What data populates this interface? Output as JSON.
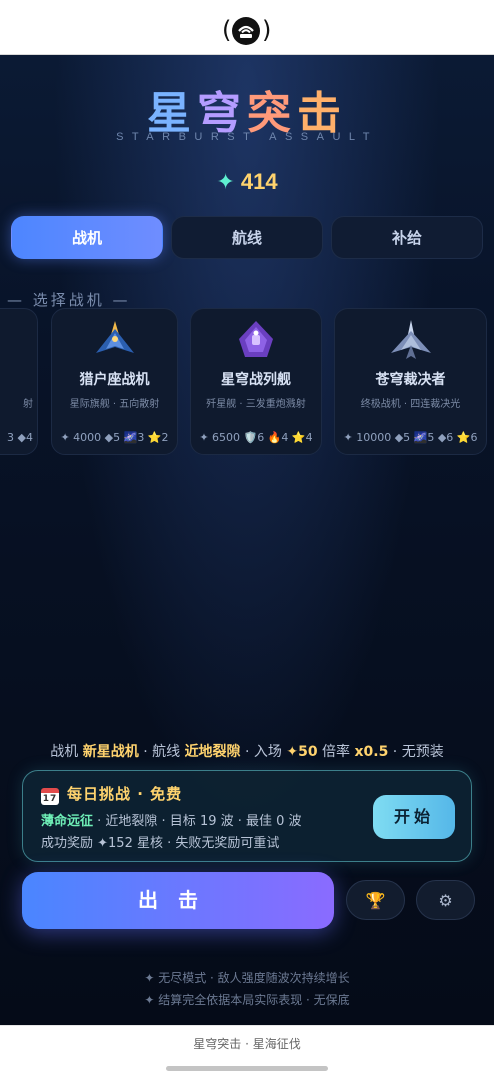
{
  "title_chars": [
    "星",
    "穹",
    "突",
    "击"
  ],
  "subtitle": "STARBURST ASSAULT",
  "currency": {
    "icon": "✦",
    "value": "414"
  },
  "tabs": [
    {
      "label": "战机",
      "active": true
    },
    {
      "label": "航线",
      "active": false
    },
    {
      "label": "补给",
      "active": false
    }
  ],
  "section_label": "— 选择战机 —",
  "ships": [
    {
      "name": "",
      "desc": "",
      "stats": "3 ◆4",
      "partial_left": "射"
    },
    {
      "name": "猎户座战机",
      "desc": "星际旗舰 · 五向散射",
      "stats": "✦ 4000 ◆5 🌌3 ⭐2"
    },
    {
      "name": "星穹战列舰",
      "desc": "歼星舰 · 三发重炮溅射",
      "stats": "✦ 6500 🛡️6 🔥4 ⭐4"
    },
    {
      "name": "苍穹裁决者",
      "desc": "终极战机 · 四连裁决光",
      "stats": "✦ 10000 ◆5 🌌5 ◆6 ⭐6"
    }
  ],
  "summary": {
    "p1": "战机 ",
    "ship": "新星战机",
    "p2": " · 航线 ",
    "route": "近地裂隙",
    "p3": " · 入场 ",
    "cost": "✦50",
    "p4": " 倍率 ",
    "mult": "x0.5",
    "p5": " · 无预装"
  },
  "daily": {
    "cal_label": "17",
    "title": "每日挑战 · 免费",
    "mode": "薄命远征",
    "line1_rest": " · 近地裂隙 · 目标 19 波 · 最佳 0 波",
    "line2": "成功奖励 ✦152 星核 · 失败无奖励可重试",
    "start_label": "开始"
  },
  "launch_label": "出击",
  "trophy_icon": "🏆",
  "settings_icon": "⚙",
  "footnotes": [
    "✦ 无尽模式 · 敌人强度随波次持续增长",
    "✦ 结算完全依据本局实际表现 · 无保底"
  ],
  "bottom_caption": "星穹突击 · 星海征伐",
  "colors": {
    "accent_blue": "#4d86ff",
    "gold": "#ffd36e",
    "teal": "#5ff0d0"
  }
}
